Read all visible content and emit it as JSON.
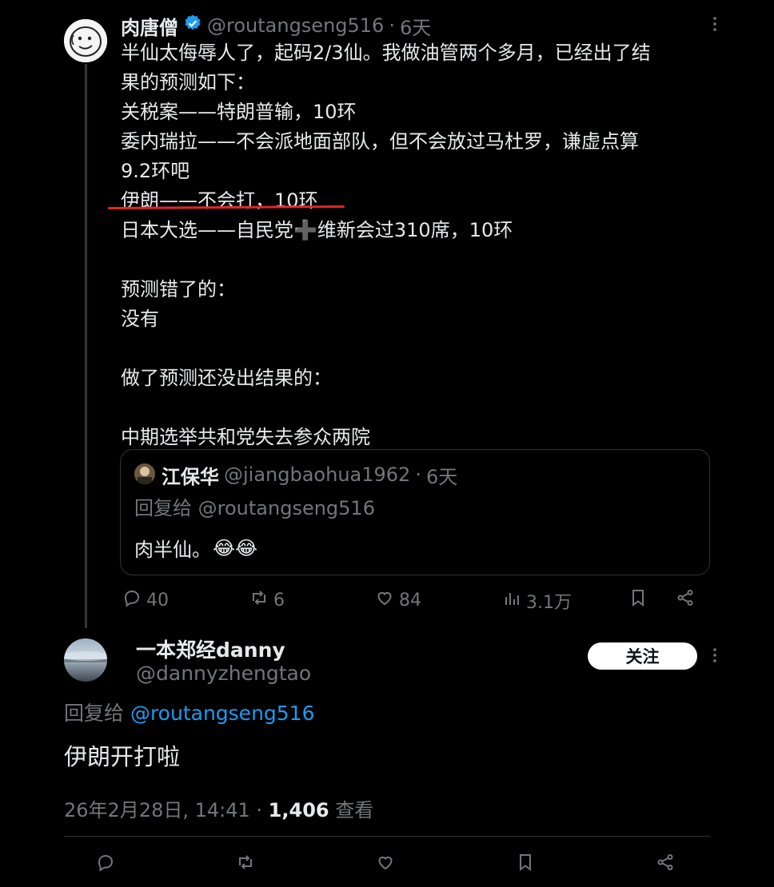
{
  "original_tweet": {
    "author_name": "肉唐僧",
    "verified": true,
    "handle": "@routangseng516",
    "dot": "·",
    "time": "6天",
    "body": "半仙太侮辱人了，起码2/3仙。我做油管两个多月，已经出了结\n果的预测如下：\n关税案——特朗普输，10环\n委内瑞拉——不会派地面部队，但不会放过马杜罗，谦虚点算\n9.2环吧\n伊朗——不会打，10环\n日本大选——自民党➕维新会过310席，10环\n\n预测错了的：\n没有\n\n做了预测还没出结果的：\n\n中期选举共和党失去参众两院",
    "quoted": {
      "author_name": "江保华",
      "handle": "@jiangbaohua1962",
      "dot": "·",
      "time": "6天",
      "reply_prefix": "回复给 ",
      "reply_to": "@routangseng516",
      "text": "肉半仙。",
      "emoji": "😂😂"
    },
    "actions": {
      "reply_count": "40",
      "retweet_count": "6",
      "like_count": "84",
      "view_count": "3.1万"
    }
  },
  "reply_tweet": {
    "author_name": "一本郑经danny",
    "handle": "@dannyzhengtao",
    "follow_label": "关注",
    "reply_prefix": "回复给 ",
    "reply_to": "@routangseng516",
    "text": "伊朗开打啦",
    "timestamp": "26年2月28日, 14:41",
    "dot": " · ",
    "views": "1,406",
    "views_label": " 查看"
  },
  "colors": {
    "background": "#000000",
    "text": "#e7e9ea",
    "muted": "#71767b",
    "link": "#1d9bf0",
    "verified": "#1d9bf0",
    "underline": "#e0262a",
    "follow_button": "#ffffff"
  },
  "icons": [
    "verified-badge-icon",
    "more-icon",
    "reply-icon",
    "retweet-icon",
    "like-icon",
    "views-icon",
    "bookmark-icon",
    "share-icon"
  ]
}
